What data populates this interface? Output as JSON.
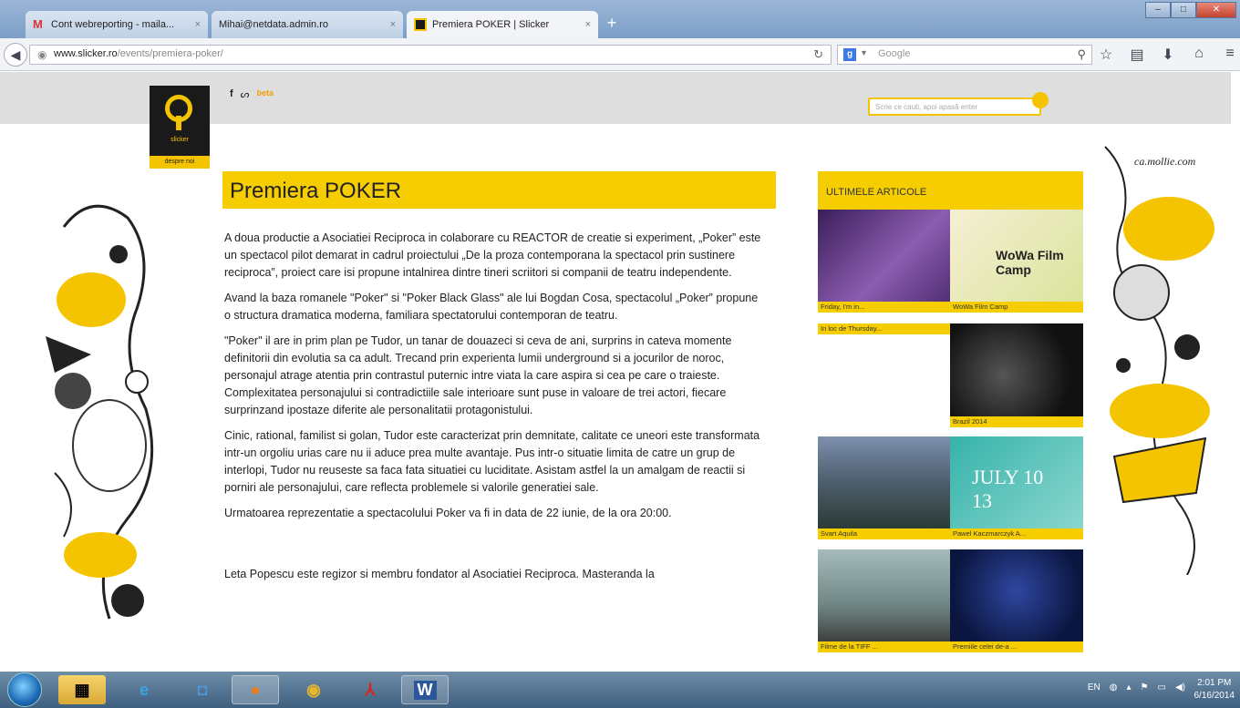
{
  "browser": {
    "tabs": [
      {
        "label": "Cont webreporting - maila..."
      },
      {
        "label": "Mihai@netdata.admin.ro"
      },
      {
        "label": "Premiera POKER | Slicker"
      }
    ],
    "new_tab": "+",
    "url_domain": "www.slicker.ro",
    "url_path": "/events/premiera-poker/",
    "search_placeholder": "Google"
  },
  "site": {
    "logo_text": "slicker",
    "despre_label": "despre noi",
    "beta_label": "beta",
    "search_placeholder": "Scrie ce cauti, apoi apasă enter",
    "title": "Premiera POKER",
    "paragraphs": [
      "A doua productie a Asociatiei Reciproca in colaborare cu REACTOR de creatie si experiment, „Poker” este un spectacol pilot demarat in cadrul proiectului „De la proza contemporana la spectacol prin sustinere reciproca”, proiect care isi propune intalnirea dintre tineri scriitori si companii de teatru independente.",
      "Avand la baza romanele \"Poker\" si \"Poker Black Glass\" ale lui Bogdan Cosa, spectacolul „Poker” propune o structura dramatica moderna, familiara spectatorului contemporan de teatru.",
      "\"Poker\" il are in prim plan pe Tudor, un tanar de douazeci si ceva de ani, surprins in cateva momente definitorii din evolutia sa ca adult. Trecand prin experienta lumii underground si a jocurilor de noroc, personajul atrage atentia prin contrastul puternic intre viata la care aspira si cea pe care o traieste. Complexitatea personajului si contradictiile sale interioare sunt puse in valoare de trei actori, fiecare surprinzand ipostaze diferite ale personalitatii protagonistului.",
      "Cinic, rational, familist si golan, Tudor este caracterizat prin demnitate, calitate ce uneori este transformata intr-un orgoliu urias care nu ii aduce prea multe avantaje. Pus intr-o situatie limita de catre un grup de interlopi, Tudor nu reuseste sa faca fata situatiei cu luciditate. Asistam astfel la un amalgam de reactii si porniri ale personajului, care reflecta problemele si valorile generatiei sale.",
      "Urmatoarea reprezentatie a spectacolului Poker va fi in data de 22 iunie, de la ora 20:00.",
      "Leta Popescu este regizor si membru fondator al Asociatiei Reciproca. Masteranda la"
    ],
    "sidebar_title": "ULTIMELE ARTICOLE",
    "articles": [
      {
        "caption": "Friday, I'm in...",
        "c1": "#4a2a6e",
        "c2": "#9a6fb8"
      },
      {
        "caption": "WoWa Film Camp",
        "c1": "#f3e9c8",
        "c2": "#c6d98a",
        "overlay": "WoWa Film Camp"
      },
      {
        "caption": "In loc de Thursday..."
      },
      {
        "caption": "Brazil 2014",
        "c1": "#1b1b1b",
        "c2": "#555"
      },
      {
        "caption": "Svart Aquila",
        "c1": "#5a6b86",
        "c2": "#2b3c34"
      },
      {
        "caption": "Pawel Kaczmarczyk A...",
        "c1": "#3bb7b0",
        "c2": "#8fd8d0",
        "overlay": "JULY 10 13"
      },
      {
        "caption": "Filme de la TIFF ...",
        "c1": "#8fa7a8",
        "c2": "#3b3a37"
      },
      {
        "caption": "Premiile celei de-a ...",
        "c1": "#0d1a46",
        "c2": "#2a3c8a"
      }
    ]
  },
  "taskbar": {
    "lang": "EN",
    "time": "2:01 PM",
    "date": "6/16/2014"
  }
}
